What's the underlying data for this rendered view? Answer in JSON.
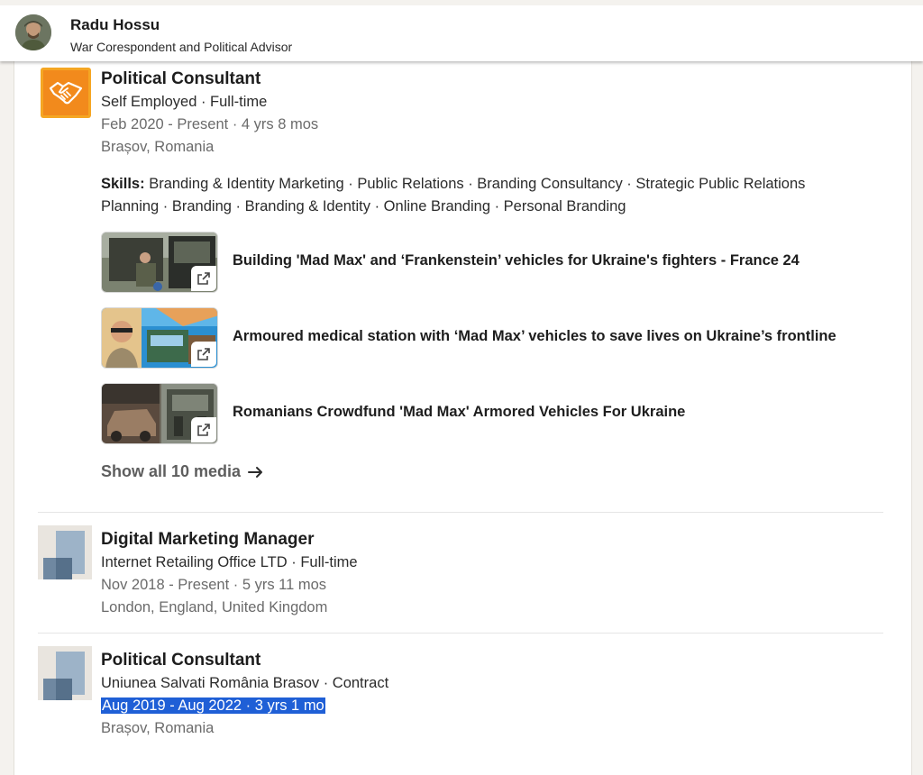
{
  "header": {
    "name": "Radu Hossu",
    "headline": "War Corespondent and Political Advisor"
  },
  "experiences": [
    {
      "title": "Political Consultant",
      "company": "Self Employed · Full-time",
      "dates": "Feb 2020 - Present · 4 yrs 8 mos",
      "location": "Brașov, Romania",
      "skills_label": "Skills:",
      "skills_text": "Branding & Identity Marketing · Public Relations · Branding Consultancy · Strategic Public Relations Planning · Branding · Branding & Identity · Online Branding · Personal Branding",
      "media": [
        {
          "title": "Building 'Mad Max' and ‘Frankenstein’ vehicles for Ukraine's fighters - France 24"
        },
        {
          "title": "Armoured medical station with ‘Mad Max’ vehicles to save lives on Ukraine’s frontline"
        },
        {
          "title": "Romanians Crowdfund 'Mad Max' Armored Vehicles For Ukraine"
        }
      ],
      "show_all": "Show all 10 media"
    },
    {
      "title": "Digital Marketing Manager",
      "company": "Internet Retailing Office LTD · Full-time",
      "dates": "Nov 2018 - Present · 5 yrs 11 mos",
      "location": "London, England, United Kingdom"
    },
    {
      "title": "Political Consultant",
      "company": "Uniunea Salvati România Brasov · Contract",
      "dates": "Aug 2019 - Aug 2022 · 3 yrs 1 mo",
      "location": "Brașov, Romania"
    }
  ],
  "icons": {
    "handshake": "handshake-icon",
    "external_link": "external-link-icon",
    "arrow_right": "arrow-right-icon"
  },
  "colors": {
    "handshake_logo": "#f28a1c",
    "selection_highlight": "#1f5fd6"
  }
}
